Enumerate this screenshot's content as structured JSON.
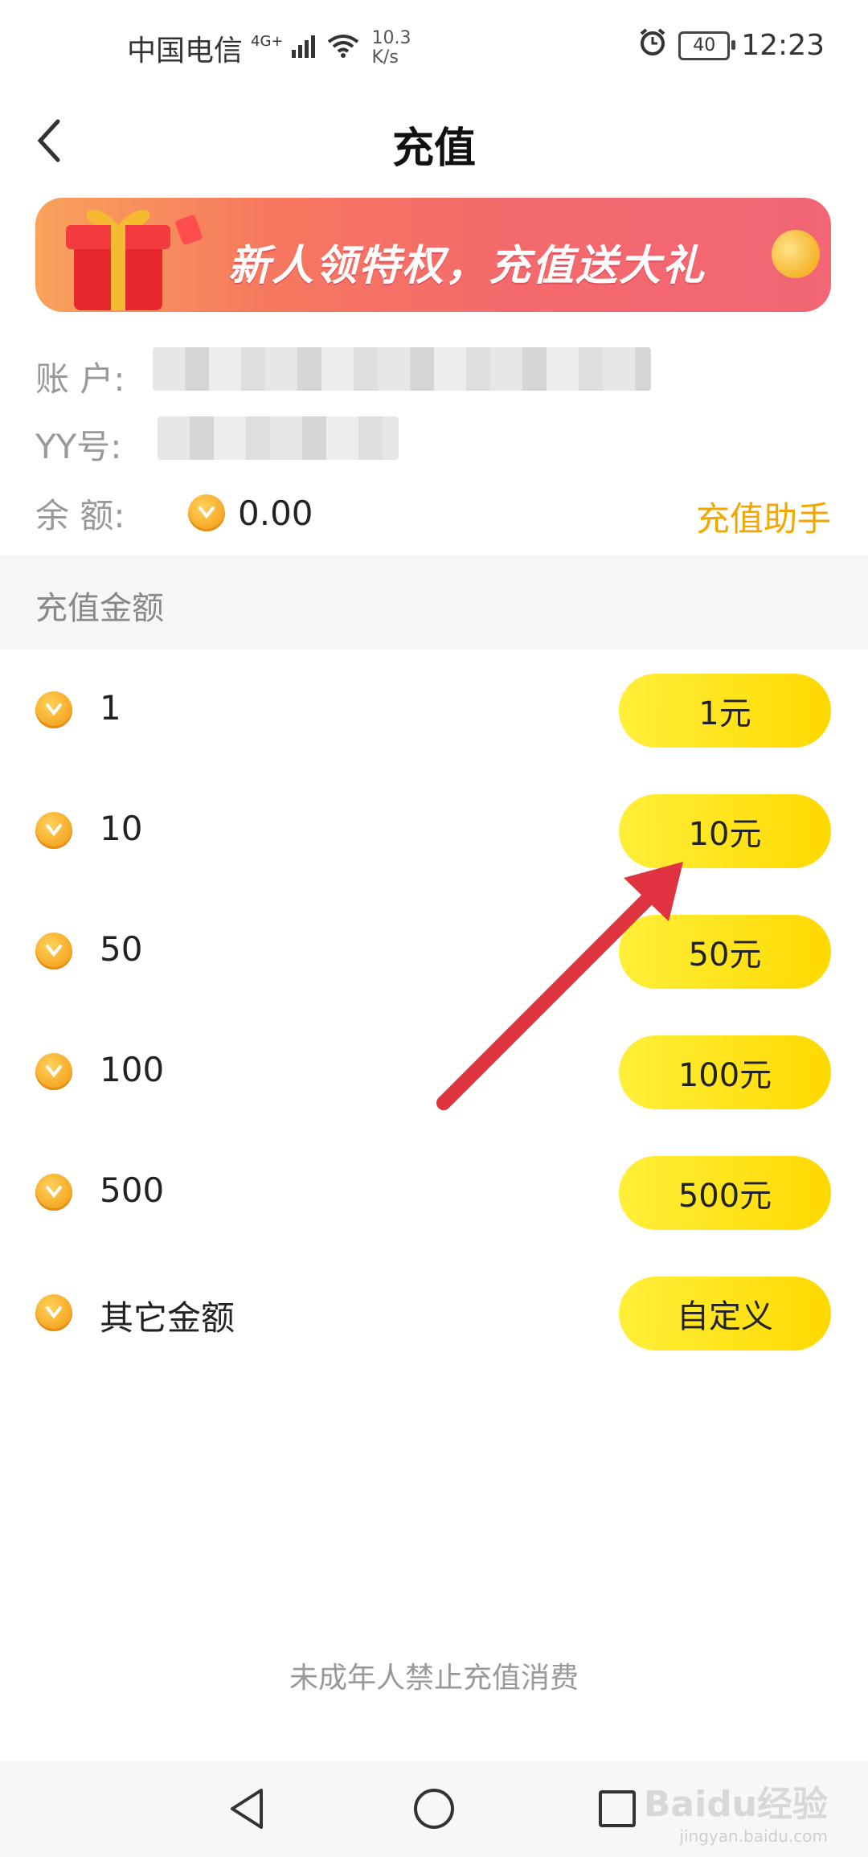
{
  "status_bar": {
    "carrier": "中国电信",
    "network": "4G+",
    "speed_value": "10.3",
    "speed_unit": "K/s",
    "battery": "40",
    "time": "12:23"
  },
  "header": {
    "title": "充值"
  },
  "banner": {
    "text": "新人领特权，充值送大礼"
  },
  "account": {
    "account_label": "账 户:",
    "yy_label": "YY号:",
    "balance_label": "余 额:",
    "balance_value": "0.00",
    "assistant_link": "充值助手"
  },
  "section": {
    "title": "充值金额"
  },
  "options": [
    {
      "amount": "1",
      "button": "1元"
    },
    {
      "amount": "10",
      "button": "10元"
    },
    {
      "amount": "50",
      "button": "50元"
    },
    {
      "amount": "100",
      "button": "100元"
    },
    {
      "amount": "500",
      "button": "500元"
    },
    {
      "amount": "其它金额",
      "button": "自定义"
    }
  ],
  "notice": "未成年人禁止充值消费",
  "watermark": {
    "brand": "Baidu经验",
    "url": "jingyan.baidu.com"
  },
  "colors": {
    "accent": "#f0a800",
    "button": "#ffe31a",
    "annotation_arrow": "#e03340"
  }
}
